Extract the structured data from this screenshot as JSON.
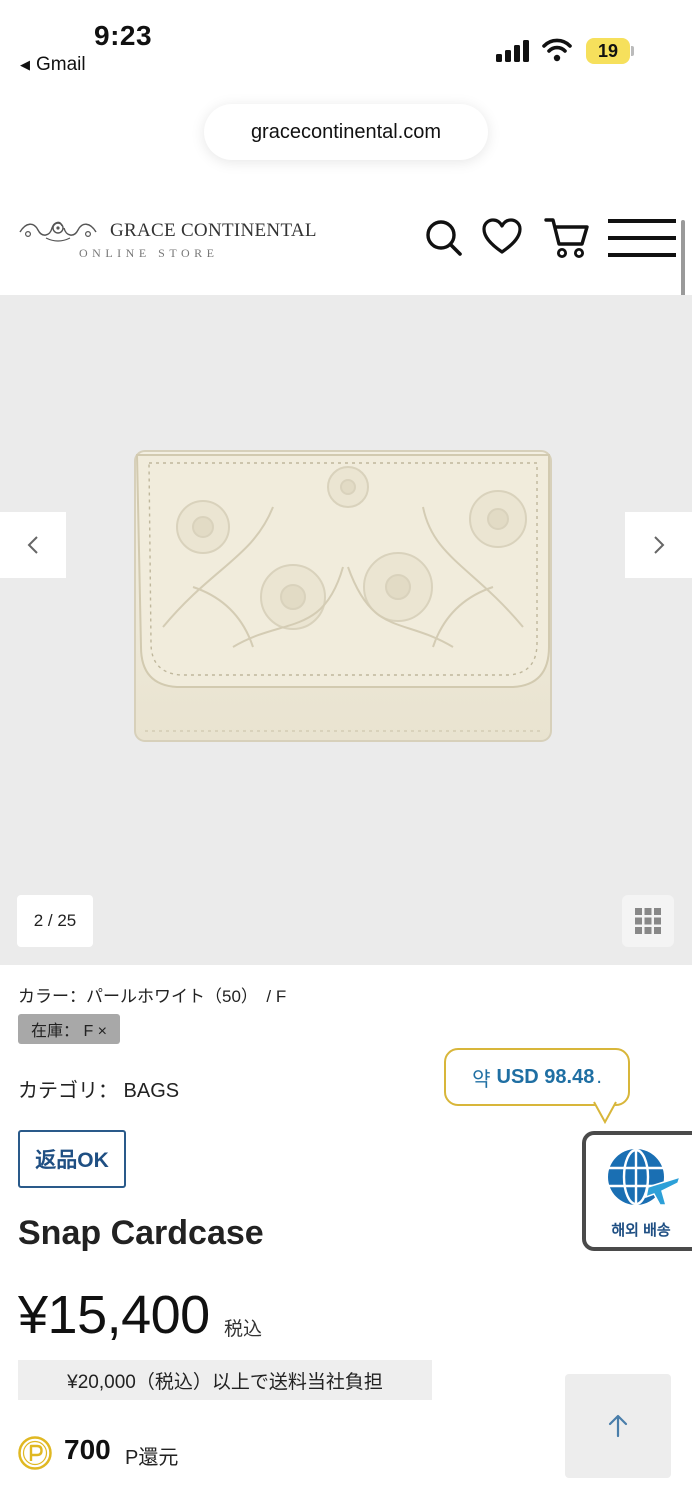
{
  "status_bar": {
    "time": "9:23",
    "back_app": "Gmail",
    "battery": "19"
  },
  "browser": {
    "url": "gracecontinental.com"
  },
  "header": {
    "logo_main": "GRACE CONTINENTAL",
    "logo_sub": "ONLINE STORE",
    "icons": [
      "search-icon",
      "heart-icon",
      "cart-icon",
      "menu-icon"
    ]
  },
  "gallery": {
    "counter": "2 / 25"
  },
  "product": {
    "color_line": "カラー：パールホワイト（50）　/ F",
    "stock": "在庫： F ×",
    "category": "カテゴリ：  BAGS",
    "return_badge": "返品OK",
    "title": "Snap Cardcase",
    "price": "¥15,400",
    "tax_label": "税込",
    "shipping_note": "¥20,000（税込）以上で送料当社負担",
    "points_value": "700",
    "points_label": "P還元"
  },
  "currency_widget": {
    "prefix": "약",
    "value": "USD 98.48",
    "suffix": ".",
    "overseas_label": "해외 배송"
  },
  "colors": {
    "accent_blue": "#1f4f83",
    "bubble_border": "#d8b63a",
    "gallery_bg": "#ebebeb",
    "battery": "#f6e05c"
  }
}
